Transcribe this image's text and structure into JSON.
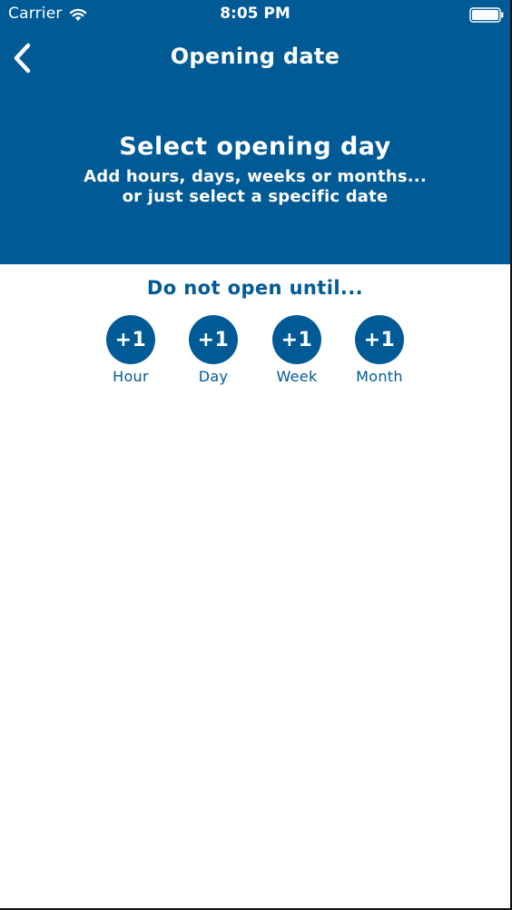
{
  "status_bar": {
    "carrier": "Carrier",
    "time": "8:05 PM",
    "wifi_icon": "wifi-icon",
    "battery_icon": "battery-icon"
  },
  "nav": {
    "title": "Opening date",
    "back_icon": "chevron-left-icon"
  },
  "hero": {
    "title": "Select opening day",
    "subtitle_line1": "Add hours, days, weeks or months...",
    "subtitle_line2": "or just select a specific date"
  },
  "section": {
    "title": "Do not open until..."
  },
  "increments": [
    {
      "value": "+1",
      "label": "Hour"
    },
    {
      "value": "+1",
      "label": "Day"
    },
    {
      "value": "+1",
      "label": "Week"
    },
    {
      "value": "+1",
      "label": "Month"
    }
  ],
  "colors": {
    "brand": "#005a96",
    "background": "#ffffff"
  }
}
